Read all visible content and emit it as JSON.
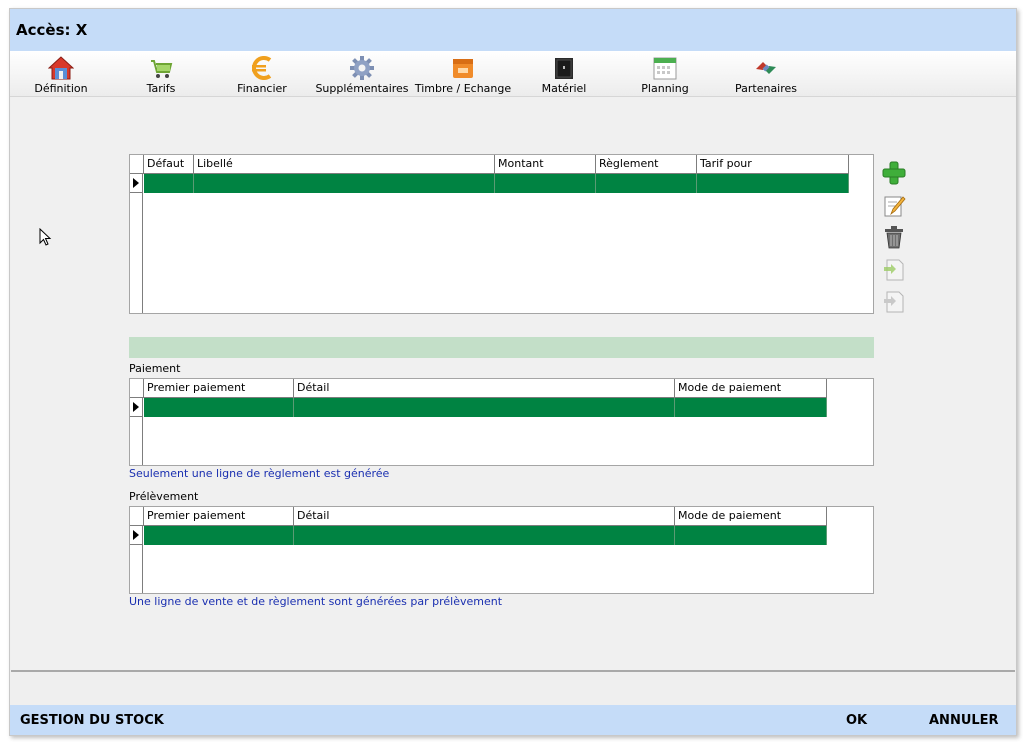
{
  "window": {
    "title": "Accès: X"
  },
  "toolbar": {
    "items": [
      {
        "label": "Définition",
        "icon": "house-icon"
      },
      {
        "label": "Tarifs",
        "icon": "cart-icon"
      },
      {
        "label": "Financier",
        "icon": "euro-icon"
      },
      {
        "label": "Supplémentaires",
        "icon": "gear-icon"
      },
      {
        "label": "Timbre / Echange",
        "icon": "stamp-icon"
      },
      {
        "label": "Matériel",
        "icon": "safe-icon"
      },
      {
        "label": "Planning",
        "icon": "calendar-icon"
      },
      {
        "label": "Partenaires",
        "icon": "handshake-icon"
      }
    ]
  },
  "tarifs_grid": {
    "columns": [
      "Défaut",
      "Libellé",
      "Montant",
      "Règlement",
      "Tarif pour"
    ]
  },
  "side_actions": {
    "add": "plus-icon",
    "edit": "pencil-icon",
    "delete": "trash-icon",
    "import": "import-icon",
    "export": "export-icon"
  },
  "paiement": {
    "label": "Paiement",
    "columns": [
      "Premier paiement",
      "Détail",
      "Mode de paiement"
    ],
    "note": "Seulement une ligne de règlement est générée"
  },
  "prelevement": {
    "label": "Prélèvement",
    "columns": [
      "Premier paiement",
      "Détail",
      "Mode de paiement"
    ],
    "note": "Une ligne de vente et de règlement sont générées par prélèvement"
  },
  "footer": {
    "stock": "GESTION DU STOCK",
    "ok": "OK",
    "cancel": "ANNULER"
  },
  "colors": {
    "title_bar": "#c5dcf8",
    "selected_row": "#008342",
    "band": "#c3dfc8",
    "note_text": "#1a2fb0"
  }
}
